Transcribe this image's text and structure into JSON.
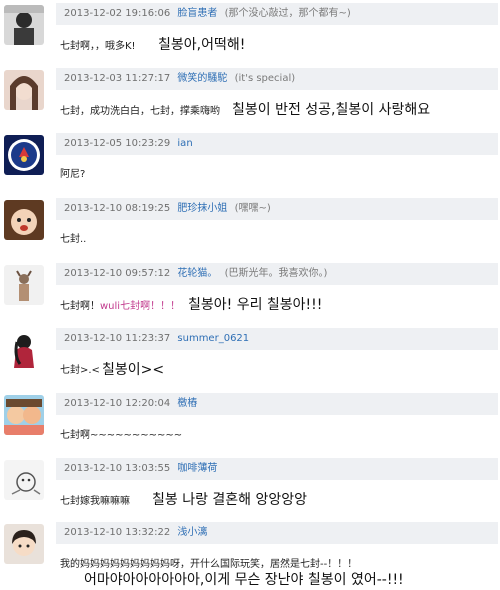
{
  "comments": [
    {
      "timestamp": "2013-12-02 19:16:06",
      "username": "脸盲患者",
      "signature": "(那个没心敲过，那个都有~)",
      "text": "七封啊，，哦多K!",
      "translation": "칠봉아,어떡해!"
    },
    {
      "timestamp": "2013-12-03 11:27:17",
      "username": "微笑的騷駝",
      "signature": "(it's special)",
      "text": "七封，成功洗白白，七封，撑乘嗨哟",
      "translation": "칠봉이 반전 성공,칠봉이 사랑해요"
    },
    {
      "timestamp": "2013-12-05 10:23:29",
      "username": "ian",
      "signature": "",
      "text": "阿尼?",
      "translation": ""
    },
    {
      "timestamp": "2013-12-10 08:19:25",
      "username": "肥珍抹小姐",
      "signature": "(嘿嘿~)",
      "text": "七封..",
      "translation": ""
    },
    {
      "timestamp": "2013-12-10 09:57:12",
      "username": "花轮猫。",
      "signature": "(巴斯光年。我喜欢你。)",
      "text": "七封啊！",
      "text_highlight": "wuli七封啊！！！",
      "translation": "칠봉아! 우리 칠봉아!!!"
    },
    {
      "timestamp": "2013-12-10 11:23:37",
      "username": "summer_0621",
      "signature": "",
      "text": "七封>.<",
      "translation": "칠봉이><"
    },
    {
      "timestamp": "2013-12-10 12:20:04",
      "username": "檄樁",
      "signature": "",
      "text": "七封啊~~~~~~~~~~~",
      "translation": ""
    },
    {
      "timestamp": "2013-12-10 13:03:55",
      "username": "咖啡薄荷",
      "signature": "",
      "text": "七封嫁我嘛嘛嘛",
      "translation": "칠봉 나랑 결혼해 앙앙앙앙"
    },
    {
      "timestamp": "2013-12-10 13:32:22",
      "username": "浅小漓",
      "signature": "",
      "text": "我的妈妈妈妈妈妈妈妈妈呀，开什么国际玩笑，居然是七封--！！！",
      "translation": "어마야아아아아아아,이게 무슨 장난야 칠봉이 였어--!!!"
    }
  ]
}
